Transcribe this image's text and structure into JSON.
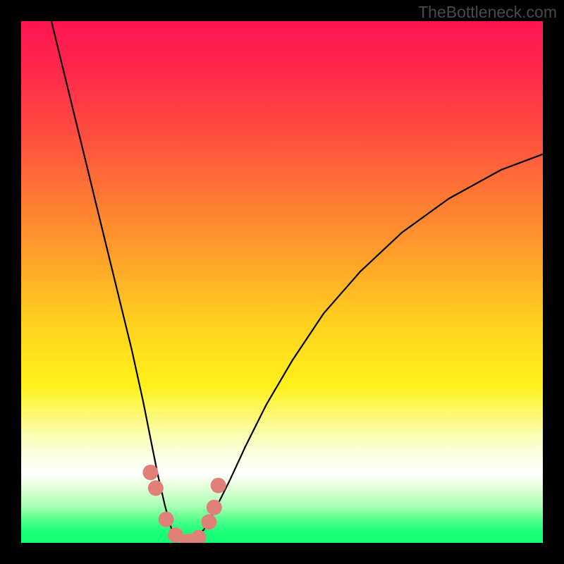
{
  "watermark": "TheBottleneck.com",
  "chart_data": {
    "type": "line",
    "title": "",
    "xlabel": "",
    "ylabel": "",
    "xlim": [
      0,
      1
    ],
    "ylim": [
      0,
      1
    ],
    "grid": false,
    "series": [
      {
        "name": "bottleneck-curve",
        "color": "#000000",
        "x": [
          0.058,
          0.08,
          0.102,
          0.124,
          0.146,
          0.168,
          0.19,
          0.212,
          0.234,
          0.248,
          0.262,
          0.276,
          0.29,
          0.31,
          0.33,
          0.35,
          0.37,
          0.4,
          0.43,
          0.47,
          0.52,
          0.58,
          0.65,
          0.73,
          0.82,
          0.92,
          1.0
        ],
        "y": [
          1.0,
          0.91,
          0.82,
          0.73,
          0.64,
          0.55,
          0.46,
          0.37,
          0.27,
          0.2,
          0.13,
          0.07,
          0.02,
          0.0,
          0.005,
          0.025,
          0.06,
          0.12,
          0.185,
          0.265,
          0.35,
          0.44,
          0.52,
          0.595,
          0.66,
          0.715,
          0.745
        ]
      }
    ],
    "markers": {
      "name": "highlight-dots",
      "color": "#e18079",
      "points": [
        {
          "x": 0.248,
          "y": 0.135
        },
        {
          "x": 0.258,
          "y": 0.105
        },
        {
          "x": 0.278,
          "y": 0.045
        },
        {
          "x": 0.296,
          "y": 0.015
        },
        {
          "x": 0.32,
          "y": 0.003
        },
        {
          "x": 0.34,
          "y": 0.01
        },
        {
          "x": 0.36,
          "y": 0.04
        },
        {
          "x": 0.37,
          "y": 0.068
        },
        {
          "x": 0.378,
          "y": 0.11
        }
      ]
    },
    "background_gradient": {
      "direction": "top-to-bottom",
      "stops": [
        {
          "pos": 0.0,
          "color": "#ff1452"
        },
        {
          "pos": 0.46,
          "color": "#ffa42a"
        },
        {
          "pos": 0.7,
          "color": "#fff21a"
        },
        {
          "pos": 0.86,
          "color": "#ffffff"
        },
        {
          "pos": 1.0,
          "color": "#12ff73"
        }
      ]
    }
  }
}
